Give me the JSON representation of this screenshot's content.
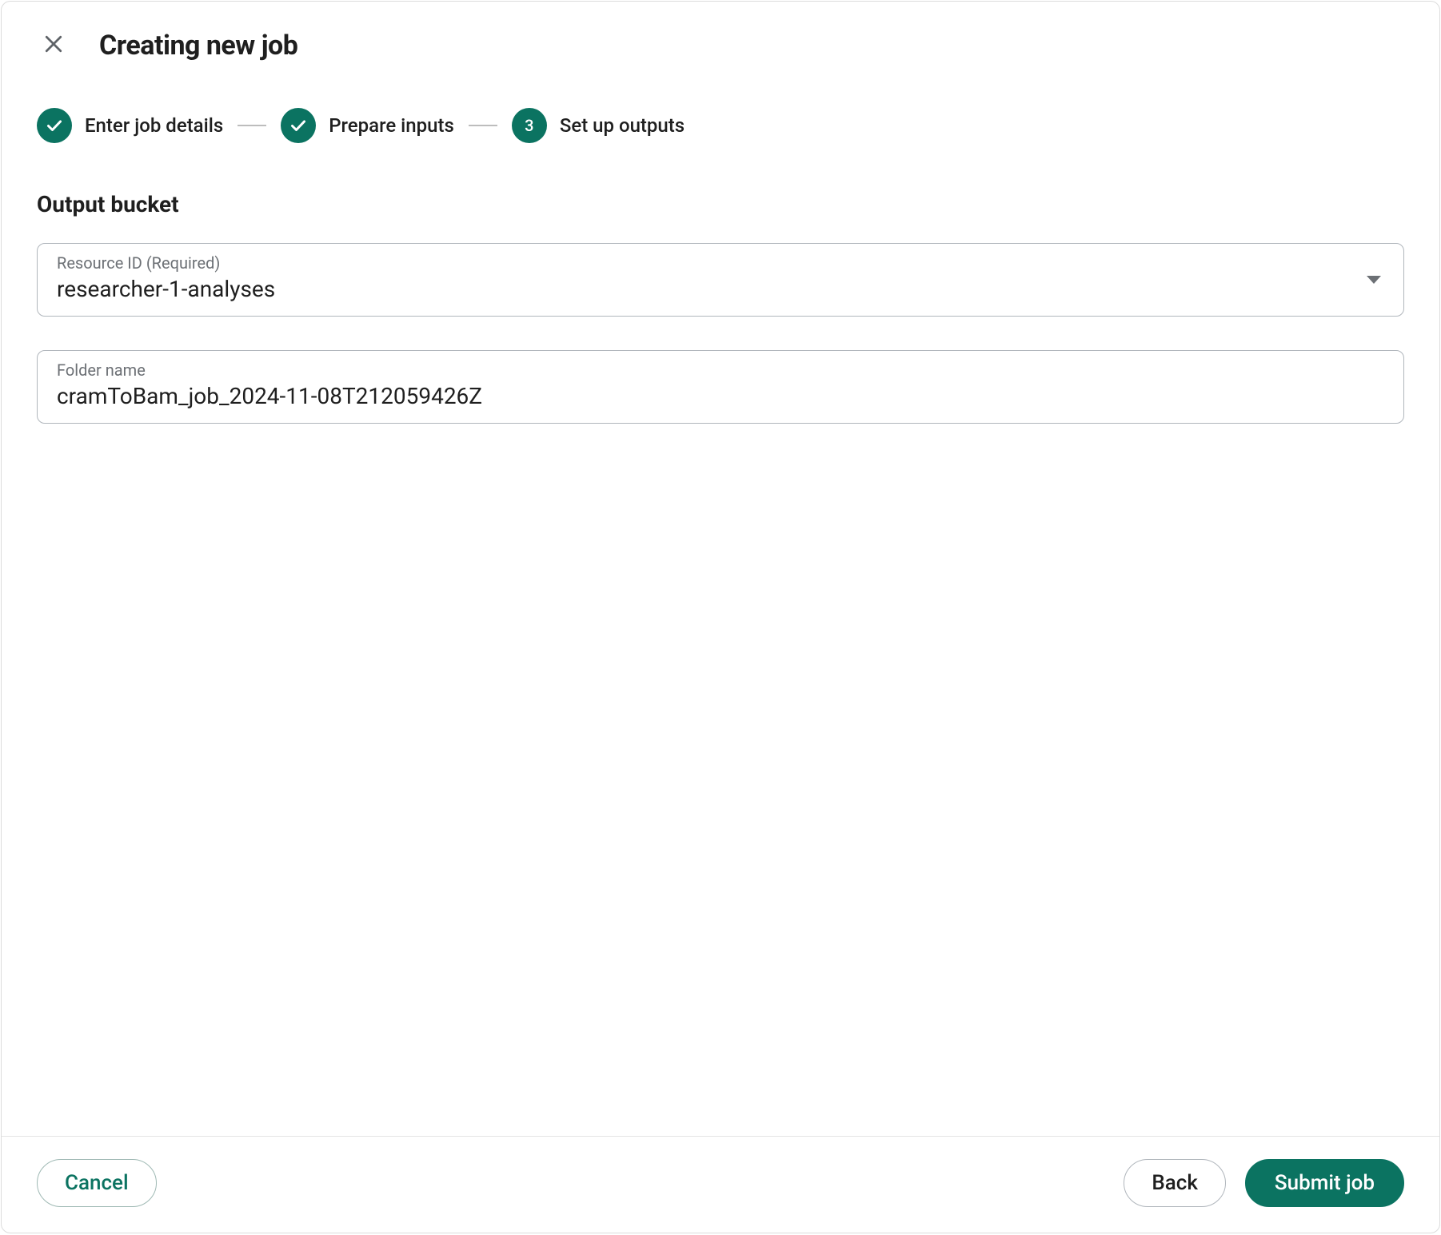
{
  "header": {
    "title": "Creating new job"
  },
  "stepper": {
    "steps": [
      {
        "label": "Enter job details",
        "badge": "check"
      },
      {
        "label": "Prepare inputs",
        "badge": "check"
      },
      {
        "label": "Set up outputs",
        "badge": "3"
      }
    ]
  },
  "section": {
    "title": "Output bucket"
  },
  "fields": {
    "resourceId": {
      "label": "Resource ID (Required)",
      "value": "researcher-1-analyses"
    },
    "folderName": {
      "label": "Folder name",
      "value": "cramToBam_job_2024-11-08T212059426Z"
    }
  },
  "footer": {
    "cancel": "Cancel",
    "back": "Back",
    "submit": "Submit job"
  }
}
